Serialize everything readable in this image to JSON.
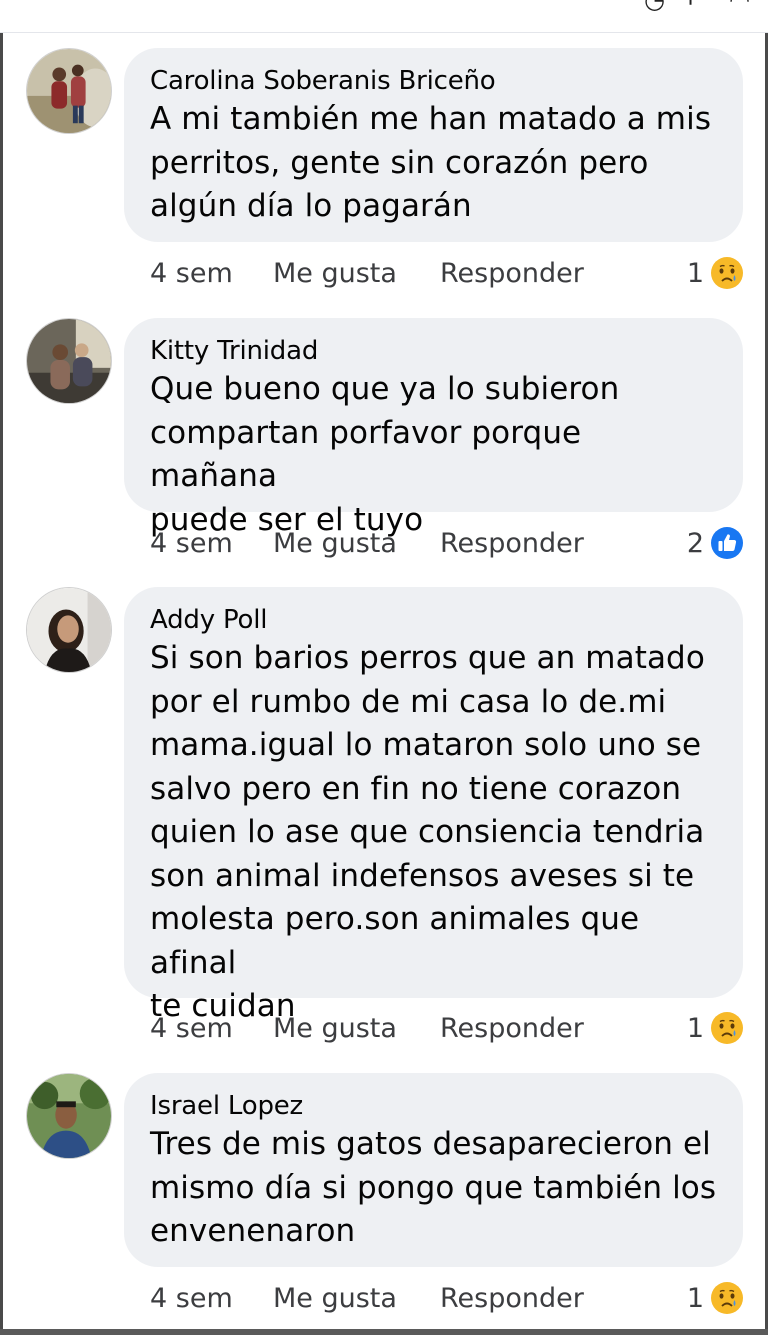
{
  "comments": [
    {
      "author": "Carolina Soberanis Briceño",
      "lines": [
        "A mi también me han matado a mis",
        "perritos, gente sin corazón pero",
        "algún día lo pagarán"
      ],
      "time": "4 sem",
      "like_label": "Me gusta",
      "reply_label": "Responder",
      "reaction_count": "1",
      "reaction_icon": "sad-face-icon",
      "avatar_colors": {
        "bg": "#b9b29c",
        "accent": "#7a4b3a"
      }
    },
    {
      "author": "Kitty Trinidad",
      "lines": [
        "Que bueno que ya lo subieron",
        "compartan porfavor porque mañana",
        "puede ser el tuyo"
      ],
      "time": "4 sem",
      "like_label": "Me gusta",
      "reply_label": "Responder",
      "reaction_count": "2",
      "reaction_icon": "thumbs-up-icon",
      "avatar_colors": {
        "bg": "#5d5a52",
        "accent": "#a08a74"
      }
    },
    {
      "author": "Addy Poll",
      "lines": [
        "Si son barios perros que an matado",
        "por el rumbo de mi casa lo de.mi",
        "mama.igual lo mataron solo uno se",
        "salvo pero en fin no tiene corazon",
        "quien lo ase que consiencia tendria",
        "son animal indefensos aveses si te",
        "molesta pero.son animales que afinal",
        "te cuidan"
      ],
      "time": "4 sem",
      "like_label": "Me gusta",
      "reply_label": "Responder",
      "reaction_count": "1",
      "reaction_icon": "sad-face-icon",
      "avatar_colors": {
        "bg": "#e6e3e0",
        "accent": "#3a2a22"
      }
    },
    {
      "author": "Israel Lopez",
      "lines": [
        "Tres de mis gatos desaparecieron el",
        "mismo día si pongo que también los",
        "envenenaron"
      ],
      "time": "4 sem",
      "like_label": "Me gusta",
      "reply_label": "Responder",
      "reaction_count": "1",
      "reaction_icon": "sad-face-icon",
      "avatar_colors": {
        "bg": "#4d6b3a",
        "accent": "#2b4d7a"
      }
    }
  ],
  "colors": {
    "bubble": "#eef0f3",
    "like_blue": "#1877f2",
    "sad_yellow": "#f7b928"
  }
}
